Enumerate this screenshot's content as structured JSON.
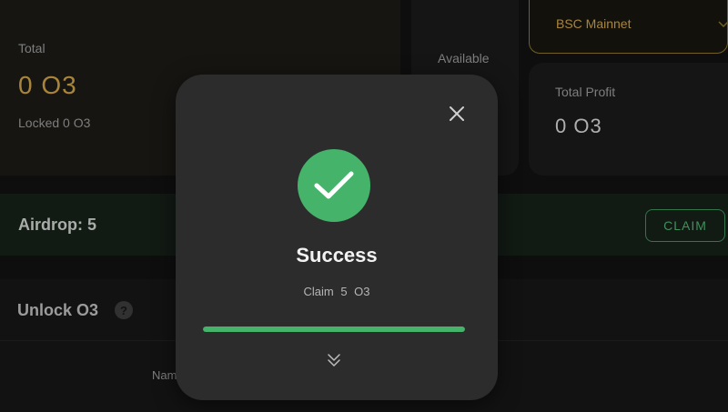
{
  "dashboard": {
    "total": {
      "label": "Total",
      "value": "0 O3",
      "locked": "Locked 0 O3"
    },
    "available": {
      "label": "Available"
    },
    "network": {
      "selected": "BSC Mainnet"
    },
    "profit": {
      "label": "Total Profit",
      "value": "0 O3"
    },
    "airdrop": {
      "label": "Airdrop: 5",
      "claim_label": "CLAIM"
    },
    "unlock": {
      "title": "Unlock O3",
      "help": "?",
      "column_name": "Nam"
    }
  },
  "modal": {
    "title": "Success",
    "message": "Claim 5 O3",
    "progress_percent": 100
  },
  "colors": {
    "accent_gold": "#cfa34a",
    "success_green": "#46b36b",
    "modal_bg": "#2c2c2c",
    "page_bg": "#121212"
  },
  "icons": {
    "close": "close-icon",
    "success": "checkmark-icon",
    "network_dropdown": "chevron-down-icon",
    "expand": "double-chevron-down-icon",
    "help": "question-icon"
  }
}
